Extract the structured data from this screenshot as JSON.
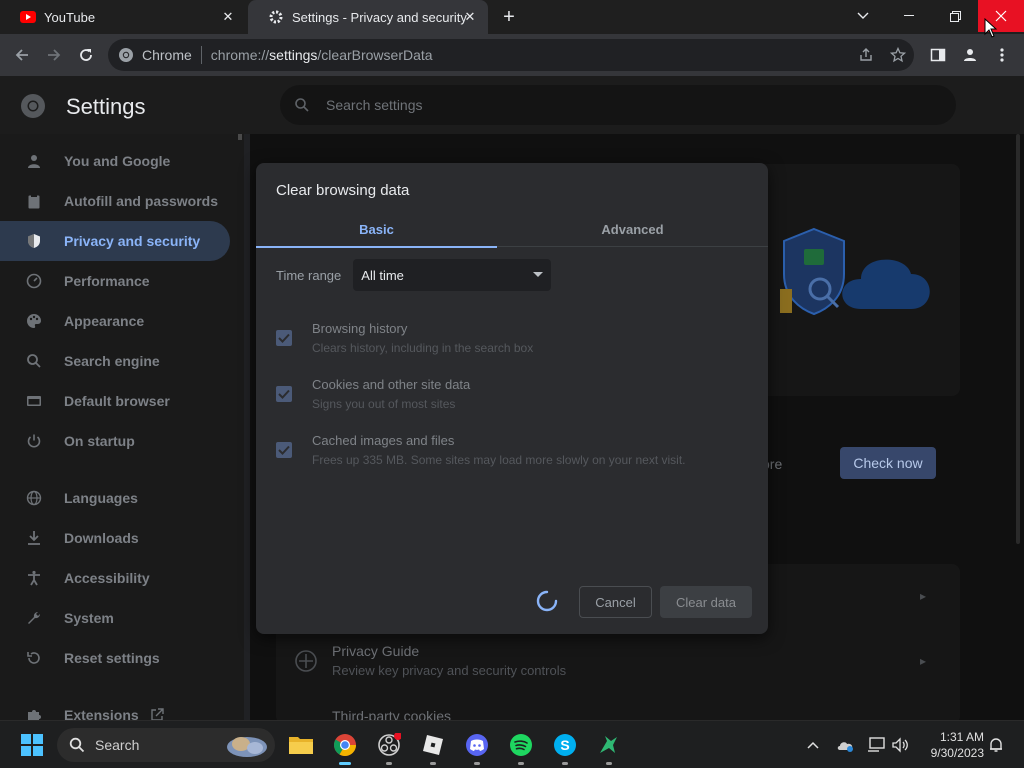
{
  "tabs": [
    {
      "title": "YouTube",
      "icon": "youtube-icon"
    },
    {
      "title": "Settings - Privacy and security",
      "icon": "gear-icon"
    }
  ],
  "toolbar": {
    "chip": "Chrome",
    "url_prefix": "chrome://",
    "url_host": "settings",
    "url_path": "/clearBrowserData"
  },
  "settings": {
    "title": "Settings",
    "search_placeholder": "Search settings"
  },
  "sidebar": {
    "items": [
      {
        "label": "You and Google",
        "icon": "person-icon"
      },
      {
        "label": "Autofill and passwords",
        "icon": "clipboard-icon"
      },
      {
        "label": "Privacy and security",
        "icon": "shield-icon"
      },
      {
        "label": "Performance",
        "icon": "speedometer-icon"
      },
      {
        "label": "Appearance",
        "icon": "palette-icon"
      },
      {
        "label": "Search engine",
        "icon": "search-icon"
      },
      {
        "label": "Default browser",
        "icon": "browser-icon"
      },
      {
        "label": "On startup",
        "icon": "power-icon"
      },
      {
        "label": "Languages",
        "icon": "globe-icon"
      },
      {
        "label": "Downloads",
        "icon": "download-icon"
      },
      {
        "label": "Accessibility",
        "icon": "accessibility-icon"
      },
      {
        "label": "System",
        "icon": "wrench-icon"
      },
      {
        "label": "Reset settings",
        "icon": "reset-icon"
      },
      {
        "label": "Extensions",
        "icon": "puzzle-icon"
      }
    ]
  },
  "background": {
    "more_fragment": "ore",
    "check_now": "Check now",
    "privacy_guide_title": "Privacy Guide",
    "privacy_guide_sub": "Review key privacy and security controls",
    "third_party_title": "Third-party cookies"
  },
  "dialog": {
    "title": "Clear browsing data",
    "tab_basic": "Basic",
    "tab_advanced": "Advanced",
    "time_range_label": "Time range",
    "time_range_value": "All time",
    "options": [
      {
        "title": "Browsing history",
        "subtitle": "Clears history, including in the search box",
        "checked": true
      },
      {
        "title": "Cookies and other site data",
        "subtitle": "Signs you out of most sites",
        "checked": true
      },
      {
        "title": "Cached images and files",
        "subtitle": "Frees up 335 MB. Some sites may load more slowly on your next visit.",
        "checked": true
      }
    ],
    "cancel": "Cancel",
    "clear_data": "Clear data"
  },
  "taskbar": {
    "search": "Search",
    "time": "1:31 AM",
    "date": "9/30/2023"
  },
  "colors": {
    "accent": "#8ab4f8",
    "close_hover": "#e81123"
  }
}
